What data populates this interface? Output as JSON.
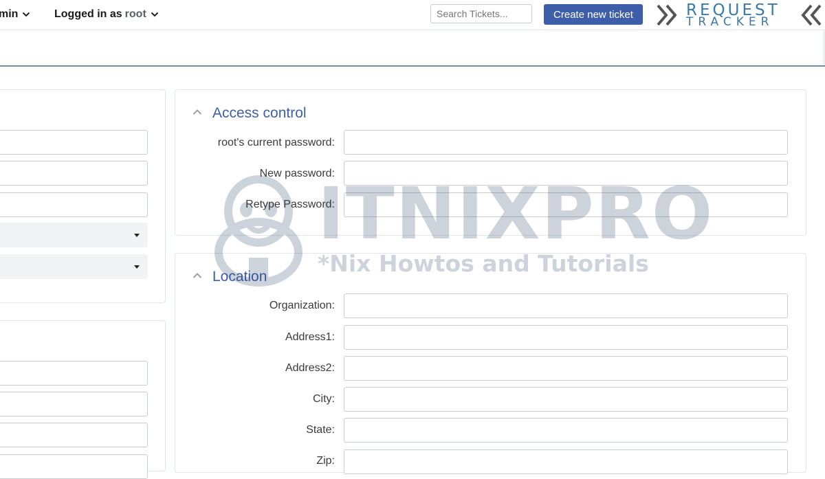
{
  "topbar": {
    "admin_menu_label": "min",
    "user_menu_prefix": "Logged in as",
    "user_menu_username": "root",
    "search_placeholder": "Search Tickets...",
    "create_ticket_label": "Create new ticket",
    "logo_line1": "REQUEST",
    "logo_line2": "TRACKER"
  },
  "access_control": {
    "title": "Access control",
    "fields": [
      {
        "label": "root's current password:",
        "value": ""
      },
      {
        "label": "New password:",
        "value": ""
      },
      {
        "label": "Retype Password:",
        "value": ""
      }
    ]
  },
  "location": {
    "title": "Location",
    "fields": [
      {
        "label": "Organization:",
        "value": ""
      },
      {
        "label": "Address1:",
        "value": ""
      },
      {
        "label": "Address2:",
        "value": ""
      },
      {
        "label": "City:",
        "value": ""
      },
      {
        "label": "State:",
        "value": ""
      },
      {
        "label": "Zip:",
        "value": ""
      }
    ]
  },
  "watermark": {
    "brand": "ITNIXPRO",
    "tagline": "*Nix Howtos and Tutorials"
  },
  "colors": {
    "accent": "#3f5ea9",
    "logo": "#3a79a8",
    "divider": "#7389b2"
  }
}
